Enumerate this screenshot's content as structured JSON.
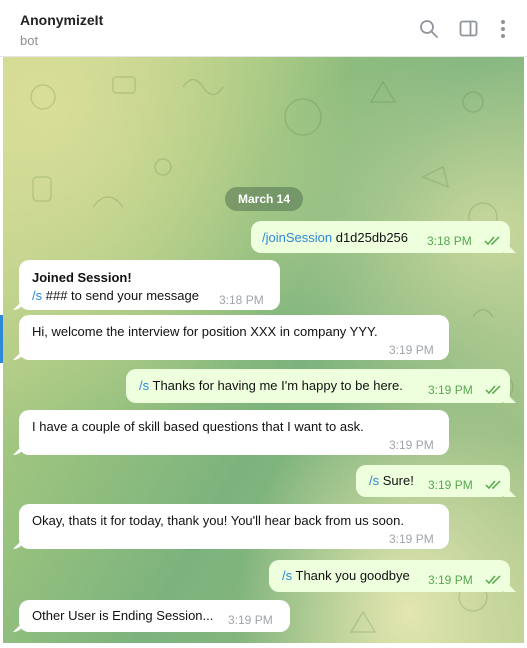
{
  "header": {
    "title": "AnonymizeIt",
    "subtitle": "bot",
    "icons": [
      "search-icon",
      "sidebar-toggle-icon",
      "more-icon"
    ]
  },
  "date_separator": "March 14",
  "messages": [
    {
      "dir": "out",
      "cmd": "/joinSession",
      "text": " d1d25db256",
      "time": "3:18 PM",
      "status": "read"
    },
    {
      "dir": "in",
      "title": "Joined Session!",
      "cmd": "/s",
      "text": " ### to send your message",
      "time": "3:18 PM"
    },
    {
      "dir": "in",
      "text": "Hi, welcome the interview for position XXX in company YYY.",
      "time": "3:19 PM"
    },
    {
      "dir": "out",
      "cmd": "/s",
      "text": " Thanks for having me I'm happy to be here.",
      "time": "3:19 PM",
      "status": "read"
    },
    {
      "dir": "in",
      "text": "I have a couple of skill based questions that I want to ask.",
      "time": "3:19 PM"
    },
    {
      "dir": "out",
      "cmd": "/s",
      "text": " Sure!",
      "time": "3:19 PM",
      "status": "read"
    },
    {
      "dir": "in",
      "text": "Okay, thats it for today, thank you! You'll hear back from us soon.",
      "time": "3:19 PM"
    },
    {
      "dir": "out",
      "cmd": "/s",
      "text": " Thank you goodbye",
      "time": "3:19 PM",
      "status": "read"
    },
    {
      "dir": "in",
      "text": "Other User is Ending Session...",
      "time": "3:19 PM"
    }
  ]
}
